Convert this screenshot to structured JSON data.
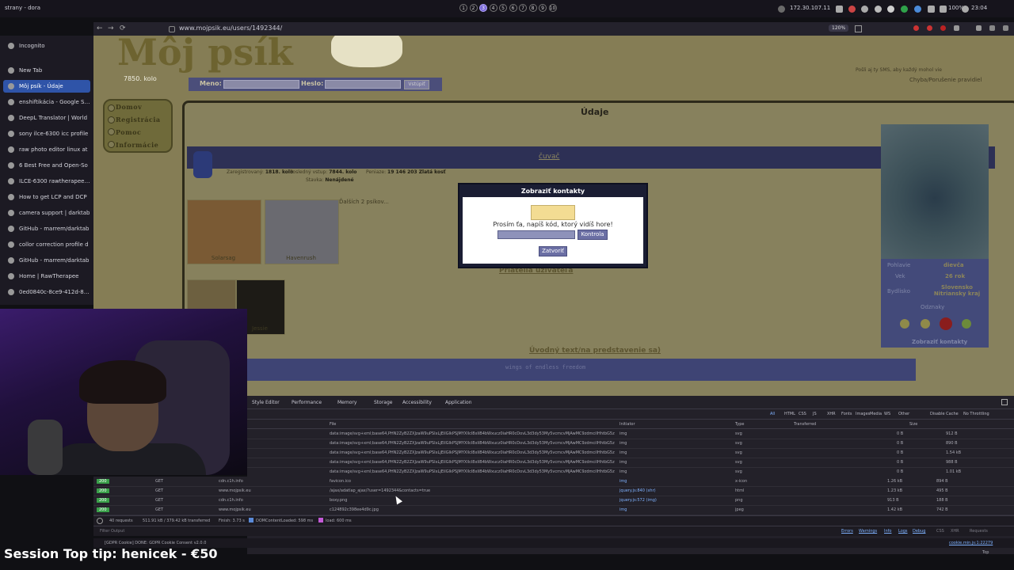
{
  "topbar": {
    "title": "strany - dora",
    "workspaces": [
      "1",
      "2",
      "3",
      "4",
      "5",
      "6",
      "7",
      "8",
      "9",
      "10"
    ],
    "active_workspace": "3",
    "ip": "172.30.107.11",
    "battery": "100%",
    "time": "23:04"
  },
  "browser": {
    "url": "www.mojpsik.eu/users/1492344/",
    "zoom": "120%",
    "nav_back": "←",
    "nav_forward": "→",
    "nav_reload": "⟳"
  },
  "sidebar": {
    "items": [
      {
        "label": "Incognito"
      },
      {
        "label": "New Tab"
      },
      {
        "label": "Môj psík - Údaje",
        "active": true
      },
      {
        "label": "enshiftikácia - Google Sea"
      },
      {
        "label": "DeepL Translator | World"
      },
      {
        "label": "sony ilce-6300 icc profile"
      },
      {
        "label": "raw photo editor linux at"
      },
      {
        "label": "6 Best Free and Open-So"
      },
      {
        "label": "ILCE-6300 rawtherapee at"
      },
      {
        "label": "How to get LCP and DCP"
      },
      {
        "label": "camera support | darktab"
      },
      {
        "label": "GitHub - marrem/darktab"
      },
      {
        "label": "collor correction profile d"
      },
      {
        "label": "GitHub - marrem/darktab"
      },
      {
        "label": "Home | RawTherapee"
      },
      {
        "label": "0ed0840c-8ce9-412d-8be"
      }
    ]
  },
  "page": {
    "brand": "Môj psík",
    "round": "7850. kolo",
    "sms_note": "Pošli aj ty SMS, aby každý mohol vie",
    "rules_link": "Chyba/Porušenie pravidiel",
    "login": {
      "name_label": "Meno:",
      "pass_label": "Heslo:",
      "button": "Vstúpiť"
    },
    "nav": [
      "Domov",
      "Registrácia",
      "Pomoc",
      "Informácie"
    ],
    "heading": "Údaje",
    "username": "čuvač",
    "stats": {
      "registered_label": "Zaregistrovaný:",
      "registered": "1818. kolo",
      "last_label": "Posledný vstup:",
      "last": "7844. kolo",
      "money_label": "Peniaze:",
      "money": "19 146 203 Zlatá kosť",
      "status_label": "Stavka:",
      "status": "Nenájdené"
    },
    "more_pets": "Ďalších 2 psíkov...",
    "pets": [
      {
        "name": "Solarsag"
      },
      {
        "name": "Havenrush"
      },
      {
        "name": ""
      },
      {
        "name": "Jessie"
      }
    ],
    "friends_link": "Priatelia užívateľa",
    "intro_link": "Úvodný text/na predstavenie sa)",
    "intro_text": "wings of endless freedom",
    "profile": {
      "gender_label": "Pohlavie",
      "gender": "dievča",
      "age_label": "Vek",
      "age": "26 rok",
      "home_label": "Bydlisko",
      "home": "Slovensko Nitriansky kraj",
      "badges_label": "Odznaky",
      "contacts_link": "Zobraziť kontakty"
    }
  },
  "modal": {
    "title": "Zobraziť kontakty",
    "prompt": "Prosím ťa, napíš kód, ktorý vidíš hore!",
    "check_button": "Kontrola",
    "close_button": "Zatvoriť"
  },
  "devtools": {
    "tabs": [
      "Style Editor",
      "Performance",
      "Memory",
      "Storage",
      "Accessibility",
      "Application"
    ],
    "filters": [
      "All",
      "HTML",
      "CSS",
      "JS",
      "XHR",
      "Fonts",
      "Images",
      "Media",
      "WS",
      "Other"
    ],
    "disable_cache": "Disable Cache",
    "throttling": "No Throttling",
    "columns": [
      "File",
      "Initiator",
      "Type",
      "Transferred",
      "Size"
    ],
    "svg_rows": [
      {
        "file": "data:image/svg+xml;base64,PHN2ZyB2ZXJzaW9uPSIxLjEiIGlkPSJMYXllcl8xIiB4bWxucz0iaHR0cDovL3d3dy53My5vcmcvMjAwMC9zdmciIHhtbG5z",
        "initiator": "img",
        "type": "svg",
        "transferred": "0 B",
        "size": "912 B"
      },
      {
        "file": "data:image/svg+xml;base64,PHN2ZyB2ZXJzaW9uPSIxLjEiIGlkPSJMYXllcl8xIiB4bWxucz0iaHR0cDovL3d3dy53My5vcmcvMjAwMC9zdmciIHhtbG5z",
        "initiator": "img",
        "type": "svg",
        "transferred": "0 B",
        "size": "890 B"
      },
      {
        "file": "data:image/svg+xml;base64,PHN2ZyB2ZXJzaW9uPSIxLjEiIGlkPSJMYXllcl8xIiB4bWxucz0iaHR0cDovL3d3dy53My5vcmcvMjAwMC9zdmciIHhtbG5z",
        "initiator": "img",
        "type": "svg",
        "transferred": "0 B",
        "size": "1.54 kB"
      },
      {
        "file": "data:image/svg+xml;base64,PHN2ZyB2ZXJzaW9uPSIxLjEiIGlkPSJMYXllcl8xIiB4bWxucz0iaHR0cDovL3d3dy53My5vcmcvMjAwMC9zdmciIHhtbG5z",
        "initiator": "img",
        "type": "svg",
        "transferred": "0 B",
        "size": "988 B"
      },
      {
        "file": "data:image/svg+xml;base64,PHN2ZyB2ZXJzaW9uPSIxLjEiIGlkPSJMYXllcl8xIiB4bWxucz0iaHR0cDovL3d3dy53My5vcmcvMjAwMC9zdmciIHhtbG5z",
        "initiator": "img",
        "type": "svg",
        "transferred": "0 B",
        "size": "1.01 kB"
      }
    ],
    "req_rows": [
      {
        "status": "200",
        "method": "GET",
        "domain": "cdn.c1h.info",
        "file": "favicon.ico",
        "initiator": "img",
        "type": "x-icon",
        "transferred": "1.26 kB",
        "size": "894 B"
      },
      {
        "status": "200",
        "method": "GET",
        "domain": "www.mojpsik.eu",
        "file": "/ajax/adatlap_ajax/?user=1492344&contacts=true",
        "initiator": "jquery.js:840 (xhr)",
        "type": "html",
        "transferred": "1.23 kB",
        "size": "495 B"
      },
      {
        "status": "200",
        "method": "GET",
        "domain": "cdn.c1h.info",
        "file": "boxy.png",
        "initiator": "jquery.js:572 (img)",
        "type": "png",
        "transferred": "913 B",
        "size": "188 B"
      },
      {
        "status": "200",
        "method": "GET",
        "domain": "www.mojpsik.eu",
        "file": "c124892c398ee4d9c.jpg",
        "initiator": "img",
        "type": "jpeg",
        "transferred": "1.42 kB",
        "size": "742 B"
      }
    ],
    "summary": {
      "requests": "40 requests",
      "size": "511.91 kB / 379.42 kB transferred",
      "finish": "Finish: 3.73 s",
      "dom": "DOMContentLoaded: 598 ms",
      "load": "load: 600 ms"
    },
    "console_filter": "Filter Output",
    "console_right": [
      "Errors",
      "Warnings",
      "Info",
      "Logs",
      "Debug",
      "CSS",
      "XHR",
      "Requests"
    ],
    "console_log": "[GDPR Cookie] DONE: GDPR Cookie Consent v2.0.0",
    "console_src": "cookie.min.js:1:22279",
    "top_label": "Top"
  },
  "overlay": {
    "tip": "Session Top tip: henicek - €50"
  }
}
